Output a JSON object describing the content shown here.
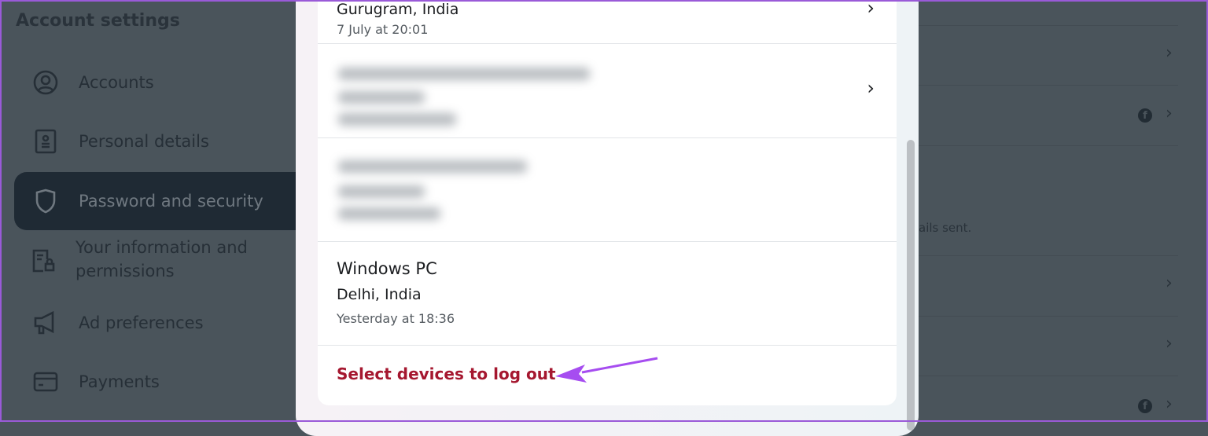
{
  "sidebar": {
    "title": "Account settings",
    "items": [
      {
        "label": "Accounts",
        "icon": "user-circle-icon"
      },
      {
        "label": "Personal details",
        "icon": "id-card-icon"
      },
      {
        "label": "Password and security",
        "icon": "shield-icon",
        "active": true
      },
      {
        "label": "Your information and permissions",
        "icon": "document-lock-icon"
      },
      {
        "label": "Ad preferences",
        "icon": "megaphone-icon"
      },
      {
        "label": "Payments",
        "icon": "credit-card-icon"
      }
    ]
  },
  "modal": {
    "devices": [
      {
        "location": "Gurugram, India",
        "time": "7 July at 20:01"
      },
      {
        "blurred": true
      },
      {
        "blurred": true
      },
      {
        "name": "Windows PC",
        "location": "Delhi, India",
        "time": "Yesterday at 18:36"
      }
    ],
    "logout_link": "Select devices to log out"
  },
  "background": {
    "partial_text": "ails sent."
  },
  "colors": {
    "link": "#a5172f",
    "annotation_arrow": "#a64df0",
    "overlay": "#4a545b"
  }
}
